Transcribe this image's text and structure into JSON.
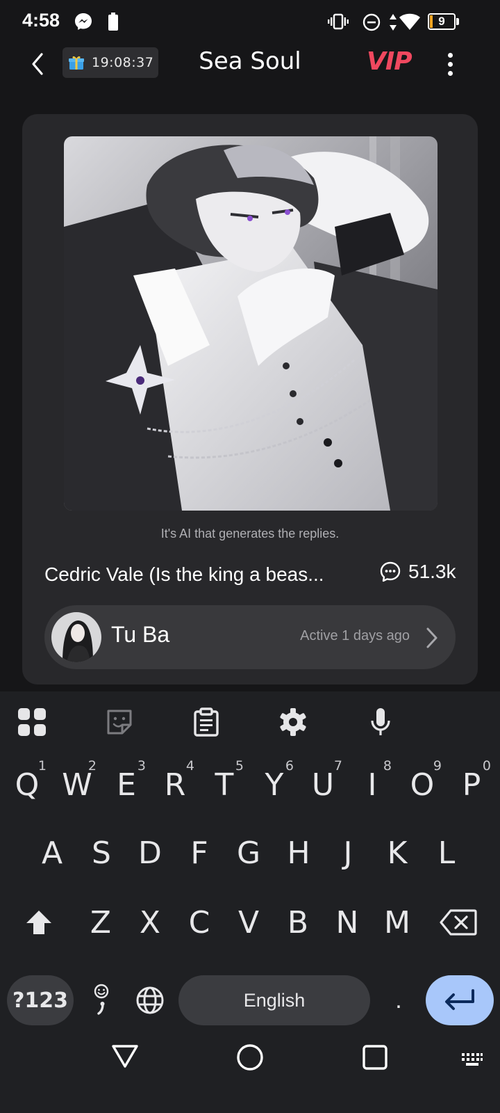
{
  "status_bar": {
    "time": "4:58",
    "battery_level": "9",
    "icons": [
      "messenger-icon",
      "battery-saver-icon",
      "vibrate-icon",
      "do-not-disturb-icon",
      "data-arrows-icon",
      "wifi-icon",
      "battery-icon"
    ]
  },
  "header": {
    "timer": "19:08:37",
    "title": "Sea Soul",
    "vip_label": "VIP",
    "vip_color": "#f0485f"
  },
  "card": {
    "disclaimer": "It's AI that generates the replies.",
    "character_name": "Cedric Vale (Is the king a beas...",
    "chat_count": "51.3k",
    "creator": {
      "name": "Tu Ba",
      "active": "Active 1 days ago"
    }
  },
  "keyboard": {
    "toolbar": [
      "apps-grid-icon",
      "sticker-icon",
      "clipboard-icon",
      "settings-gear-icon",
      "microphone-icon"
    ],
    "row1": [
      {
        "k": "Q",
        "h": "1"
      },
      {
        "k": "W",
        "h": "2"
      },
      {
        "k": "E",
        "h": "3"
      },
      {
        "k": "R",
        "h": "4"
      },
      {
        "k": "T",
        "h": "5"
      },
      {
        "k": "Y",
        "h": "6"
      },
      {
        "k": "U",
        "h": "7"
      },
      {
        "k": "I",
        "h": "8"
      },
      {
        "k": "O",
        "h": "9"
      },
      {
        "k": "P",
        "h": "0"
      }
    ],
    "row2": [
      "A",
      "S",
      "D",
      "F",
      "G",
      "H",
      "J",
      "K",
      "L"
    ],
    "row3": [
      "Z",
      "X",
      "C",
      "V",
      "B",
      "N",
      "M"
    ],
    "symbols_label": "?123",
    "space_label": "English",
    "period_label": ".",
    "enter_color": "#a8c7fa"
  },
  "navbar": {
    "buttons": [
      "back-triangle-icon",
      "home-circle-icon",
      "recents-square-icon",
      "keyboard-switch-icon"
    ]
  }
}
